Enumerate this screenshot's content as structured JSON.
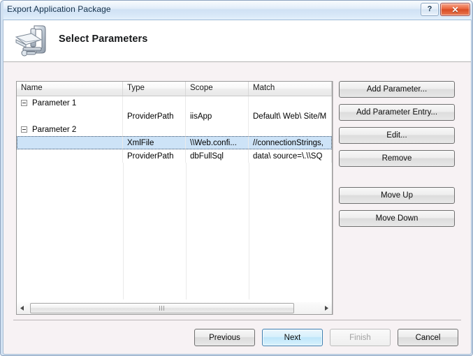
{
  "window": {
    "title": "Export Application Package",
    "help_button": "?",
    "close_button": "✕"
  },
  "header": {
    "icon": "export-package-icon",
    "title": "Select Parameters"
  },
  "grid": {
    "columns": [
      {
        "key": "name",
        "label": "Name"
      },
      {
        "key": "type",
        "label": "Type"
      },
      {
        "key": "scope",
        "label": "Scope"
      },
      {
        "key": "match",
        "label": "Match"
      }
    ],
    "rows": [
      {
        "kind": "group",
        "expander": "collapse-minus-icon",
        "name": "Parameter 1",
        "type": "",
        "scope": "",
        "match": "",
        "selected": false
      },
      {
        "kind": "entry",
        "name": "",
        "type": "ProviderPath",
        "scope": "iisApp",
        "match": "Default\\ Web\\ Site/M",
        "selected": false
      },
      {
        "kind": "group",
        "expander": "collapse-minus-icon",
        "name": "Parameter 2",
        "type": "",
        "scope": "",
        "match": "",
        "selected": false
      },
      {
        "kind": "entry",
        "name": "",
        "type": "XmlFile",
        "scope": "\\\\Web.confi...",
        "match": "//connectionStrings,",
        "selected": true
      },
      {
        "kind": "entry",
        "name": "",
        "type": "ProviderPath",
        "scope": "dbFullSql",
        "match": "data\\ source=\\.\\\\SQ",
        "selected": false
      }
    ],
    "scrollbar": {
      "left_arrow": "scroll-left-icon",
      "right_arrow": "scroll-right-icon",
      "grip": "scrollbar-grip-icon"
    }
  },
  "side_buttons": [
    {
      "id": "add-parameter",
      "label": "Add Parameter..."
    },
    {
      "id": "add-parameter-entry",
      "label": "Add Parameter Entry..."
    },
    {
      "id": "edit",
      "label": "Edit..."
    },
    {
      "id": "remove",
      "label": "Remove"
    },
    {
      "id": "move-up",
      "label": "Move Up"
    },
    {
      "id": "move-down",
      "label": "Move Down"
    }
  ],
  "bottom_buttons": [
    {
      "id": "previous",
      "label": "Previous",
      "state": "normal"
    },
    {
      "id": "next",
      "label": "Next",
      "state": "default"
    },
    {
      "id": "finish",
      "label": "Finish",
      "state": "disabled"
    },
    {
      "id": "cancel",
      "label": "Cancel",
      "state": "normal"
    }
  ],
  "colors": {
    "titlebar": "#d8e8f8",
    "close_button": "#e9643c",
    "selection": "#cde3f7",
    "default_button": "#bee6fa",
    "body_background": "#f7f2f4"
  }
}
